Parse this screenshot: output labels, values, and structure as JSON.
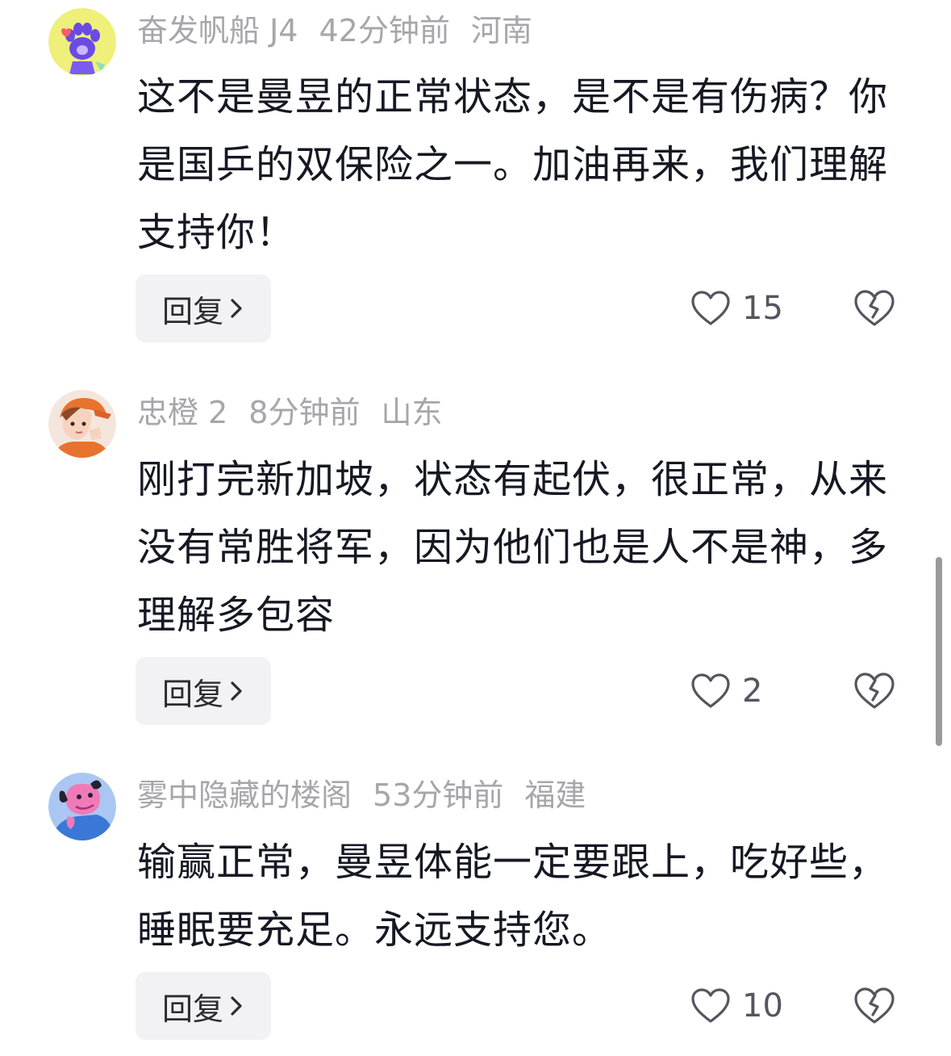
{
  "comments": [
    {
      "username": "奋发帆船 J4",
      "time": "42分钟前",
      "location": "河南",
      "text": "这不是曼昱的正常状态，是不是有伤病？你是国乒的双保险之一。加油再来，我们理解支持你！",
      "reply_label": "回复",
      "likes": "15",
      "avatar": "cat-paw-icon"
    },
    {
      "username": "忠橙 2",
      "time": "8分钟前",
      "location": "山东",
      "text": "刚打完新加坡，状态有起伏，很正常，从来没有常胜将军，因为他们也是人不是神，多理解多包容",
      "reply_label": "回复",
      "likes": "2",
      "avatar": "boy-orange-cap-avatar"
    },
    {
      "username": "雾中隐藏的楼阁",
      "time": "53分钟前",
      "location": "福建",
      "text": "输赢正常，曼昱体能一定要跟上，吃好些，睡眠要充足。永远支持您。",
      "reply_label": "回复",
      "likes": "10",
      "avatar": "pink-dog-avatar"
    }
  ],
  "icons": {
    "like": "heart-outline-icon",
    "dislike": "broken-heart-icon",
    "reply_chevron": "chevron-right-icon"
  },
  "colors": {
    "meta_text": "#a6a6ab",
    "body_text": "#161823",
    "reply_bg": "#f2f2f4"
  }
}
